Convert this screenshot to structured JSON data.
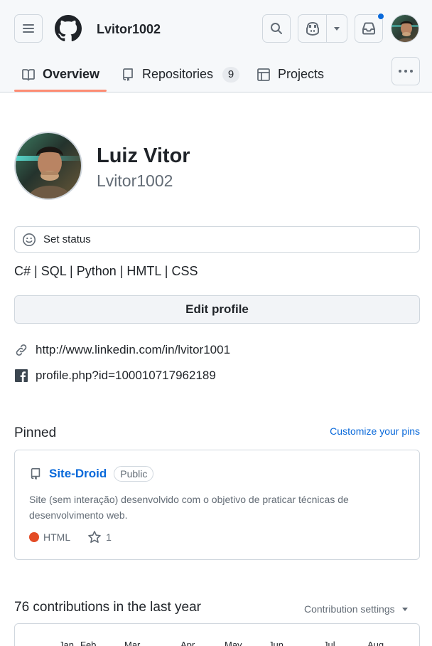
{
  "header": {
    "username": "Lvitor1002",
    "menu_icon": "hamburger-icon",
    "logo_icon": "github-logo-icon",
    "search_icon": "search-icon",
    "copilot_icon": "copilot-icon",
    "dropdown_icon": "triangle-down-icon",
    "inbox_icon": "inbox-icon",
    "notification_color": "#0969da"
  },
  "tabs": [
    {
      "label": "Overview",
      "icon": "book-icon",
      "selected": true
    },
    {
      "label": "Repositories",
      "icon": "repo-icon",
      "count": "9"
    },
    {
      "label": "Projects",
      "icon": "table-icon"
    }
  ],
  "more_icon": "kebab-horizontal-icon",
  "profile": {
    "full_name": "Luiz Vitor",
    "login": "Lvitor1002",
    "status_label": "Set status",
    "bio": "C# | SQL | Python | HMTL | CSS",
    "edit_button": "Edit profile",
    "links": [
      {
        "icon": "link-icon",
        "text": "http://www.linkedin.com/in/lvitor1001"
      },
      {
        "icon": "facebook-icon",
        "text": "profile.php?id=100010717962189"
      }
    ]
  },
  "pinned": {
    "title": "Pinned",
    "customize_label": "Customize your pins",
    "repo": {
      "name": "Site-Droid",
      "visibility": "Public",
      "description": "Site (sem interação) desenvolvido com o objetivo de praticar técnicas de desenvolvimento web.",
      "language": "HTML",
      "language_color": "#e34c26",
      "stars": "1"
    }
  },
  "contributions": {
    "title": "76 contributions in the last year",
    "settings_label": "Contribution settings",
    "months": [
      "Jan",
      "Feb",
      "Mar",
      "Apr",
      "May",
      "Jun",
      "Jul",
      "Aug"
    ]
  },
  "colors": {
    "accent_link": "#0969da",
    "tab_underline": "#fd8c73",
    "border": "#d0d7de"
  }
}
